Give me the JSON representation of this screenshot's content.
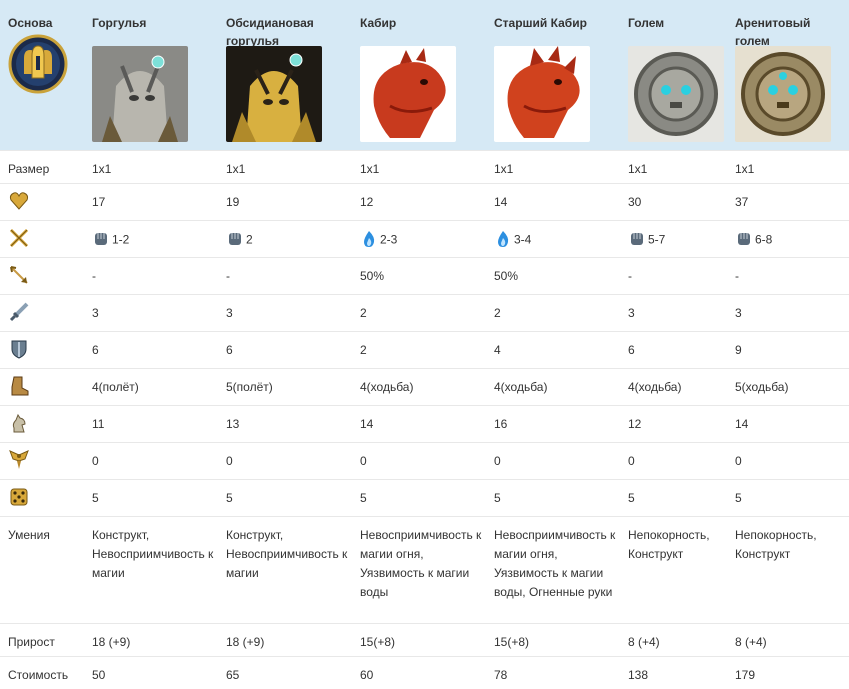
{
  "header": {
    "base_label": "Основа",
    "units": [
      {
        "name": "Горгулья"
      },
      {
        "name": "Обсидиановая горгулья"
      },
      {
        "name": "Кабир"
      },
      {
        "name": "Старший Кабир"
      },
      {
        "name": "Голем"
      },
      {
        "name": "Аренитовый голем"
      }
    ]
  },
  "rows": {
    "size": {
      "label": "Размер",
      "values": [
        "1x1",
        "1x1",
        "1x1",
        "1x1",
        "1x1",
        "1x1"
      ]
    },
    "health": {
      "icon": "heart-icon",
      "values": [
        "17",
        "19",
        "12",
        "14",
        "30",
        "37"
      ]
    },
    "damage": {
      "icon": "crossed-swords-icon",
      "values": [
        {
          "type": "fist-icon",
          "value": "1-2"
        },
        {
          "type": "fist-icon",
          "value": "2"
        },
        {
          "type": "fire-icon",
          "value": "2-3"
        },
        {
          "type": "fire-icon",
          "value": "3-4"
        },
        {
          "type": "fist-icon",
          "value": "5-7"
        },
        {
          "type": "fist-icon",
          "value": "6-8"
        }
      ]
    },
    "ranged": {
      "icon": "arrow-icon",
      "values": [
        "-",
        "-",
        "50%",
        "50%",
        "-",
        "-"
      ]
    },
    "attack": {
      "icon": "sword-icon",
      "values": [
        "3",
        "3",
        "2",
        "2",
        "3",
        "3"
      ]
    },
    "defense": {
      "icon": "shield-icon",
      "values": [
        "6",
        "6",
        "2",
        "4",
        "6",
        "9"
      ]
    },
    "movement": {
      "icon": "boot-icon",
      "values": [
        "4(полёт)",
        "5(полёт)",
        "4(ходьба)",
        "4(ходьба)",
        "4(ходьба)",
        "5(ходьба)"
      ]
    },
    "initiative": {
      "icon": "knight-icon",
      "values": [
        "11",
        "13",
        "14",
        "16",
        "12",
        "14"
      ]
    },
    "morale": {
      "icon": "eagle-icon",
      "values": [
        "0",
        "0",
        "0",
        "0",
        "0",
        "0"
      ]
    },
    "luck": {
      "icon": "dice-icon",
      "values": [
        "5",
        "5",
        "5",
        "5",
        "5",
        "5"
      ]
    },
    "abilities": {
      "label": "Умения",
      "values": [
        "Конструкт, Невосприимчивость к магии",
        "Конструкт, Невосприимчивость к магии",
        "Невосприимчивость к магии огня, Уязвимость к магии воды",
        "Невосприимчивость к магии огня, Уязвимость к магии воды, Огненные руки",
        "Непокорность, Конструкт",
        "Непокорность, Конструкт"
      ]
    },
    "growth": {
      "label": "Прирост",
      "values": [
        "18 (+9)",
        "18 (+9)",
        "15(+8)",
        "15(+8)",
        "8 (+4)",
        "8 (+4)"
      ]
    },
    "cost": {
      "label": "Стоимость",
      "values": [
        "50",
        "65",
        "60",
        "78",
        "138",
        "179"
      ]
    }
  },
  "colors": {
    "header_bg": "#d6e9f5",
    "alt_row": "#f5f5f5",
    "gold": "#c9a23a",
    "fire": "#2c8fe0"
  }
}
